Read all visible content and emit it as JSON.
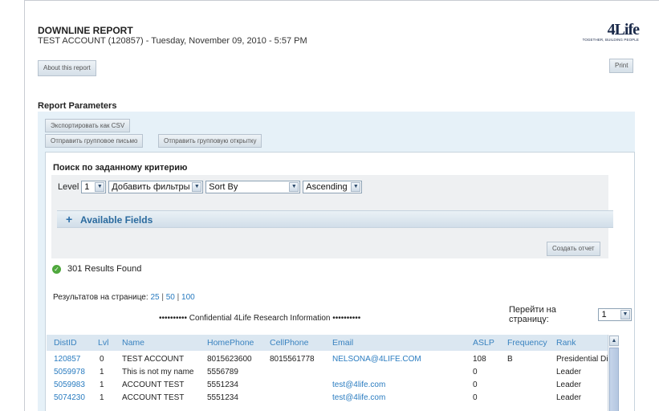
{
  "report": {
    "title": "DOWNLINE REPORT",
    "subtitle": "TEST ACCOUNT (120857) - Tuesday, November 09, 2010 - 5:57 PM"
  },
  "logo": {
    "mark": "4Life",
    "tagline": "TOGETHER, BUILDING PEOPLE"
  },
  "buttons": {
    "about": "About this report",
    "print": "Print",
    "export_csv": "Экспортировать как CSV",
    "send_group_mail": "Отправить групповое письмо",
    "send_group_card": "Отправить групповую открытку",
    "create_report": "Создать отчет"
  },
  "params": {
    "title": "Report Parameters"
  },
  "search": {
    "title": "Поиск по заданному критерию",
    "level_label": "Level",
    "level_value": "1",
    "filters_value": "Добавить фильтры",
    "sortby_value": "Sort By",
    "order_value": "Ascending"
  },
  "available_fields": {
    "plus": "+",
    "label": "Available Fields"
  },
  "results": {
    "text": "301 Results Found"
  },
  "per_page": {
    "label": "Результатов на странице:",
    "options": [
      "25",
      "50",
      "100"
    ],
    "sep": "|"
  },
  "goto_page": {
    "label": "Перейти на страницу:",
    "value": "1"
  },
  "confidential": "•••••••••• Confidential 4Life Research Information ••••••••••",
  "table": {
    "headers": [
      "DistID",
      "Lvl",
      "Name",
      "HomePhone",
      "CellPhone",
      "Email",
      "ASLP",
      "Frequency",
      "Rank"
    ],
    "rows": [
      [
        "120857",
        "0",
        "TEST ACCOUNT",
        "8015623600",
        "8015561778",
        "NELSONA@4LIFE.COM",
        "108",
        "B",
        "Presidential Diamond"
      ],
      [
        "5059978",
        "1",
        "This is not my name",
        "5556789",
        "",
        "",
        "0",
        "",
        "Leader"
      ],
      [
        "5059983",
        "1",
        "ACCOUNT TEST",
        "5551234",
        "",
        "test@4life.com",
        "0",
        "",
        "Leader"
      ],
      [
        "5074230",
        "1",
        "ACCOUNT TEST",
        "5551234",
        "",
        "test@4life.com",
        "0",
        "",
        "Leader"
      ]
    ]
  },
  "icons": {
    "dropdown": "chevron-down-icon",
    "scroll_up": "chevron-up-icon",
    "success": "check-circle-icon"
  },
  "colors": {
    "link": "#2a7cc0",
    "params_bg": "#e6f1f8",
    "header_bg": "#dbe7f1",
    "success": "#4fa83d"
  }
}
